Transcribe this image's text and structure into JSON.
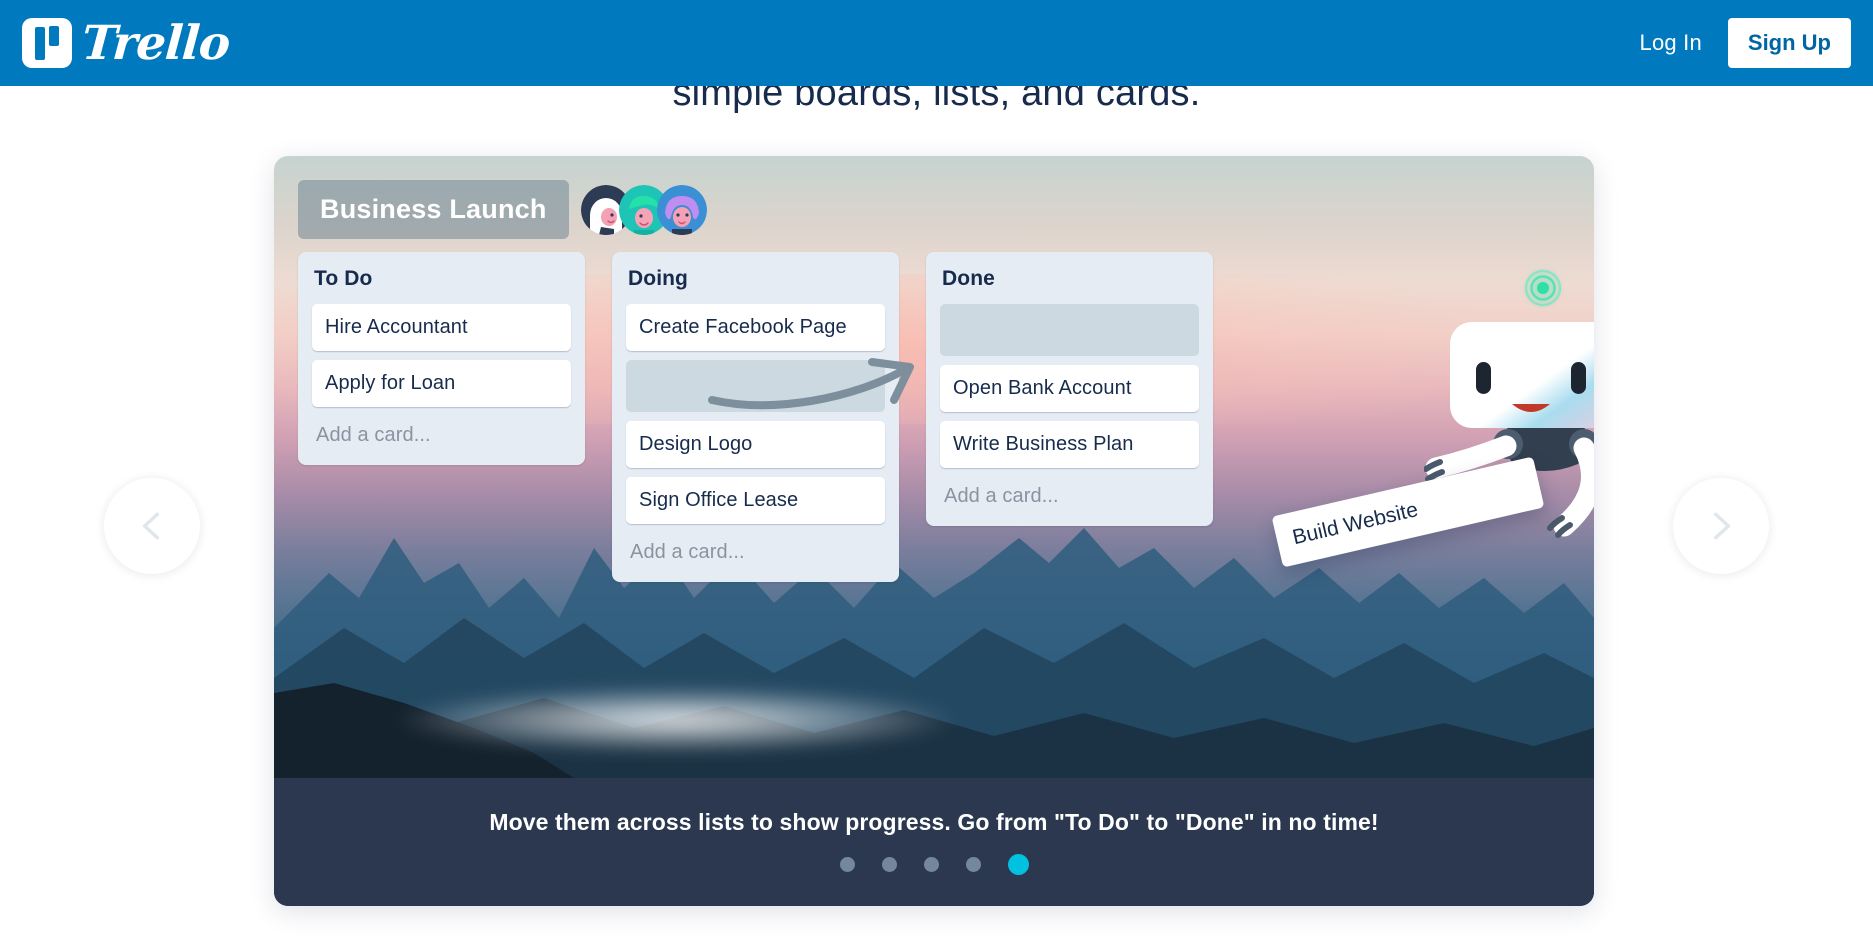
{
  "header": {
    "brand_name": "Trello",
    "login_label": "Log In",
    "signup_label": "Sign Up",
    "background_color": "#0079bf"
  },
  "hero": {
    "headline_fragment": "simple boards, lists, and cards."
  },
  "carousel": {
    "prev_label": "Previous slide",
    "next_label": "Next slide",
    "caption": "Move them across lists to show progress. Go from \"To Do\" to \"Done\" in no time!",
    "active_index": 4,
    "dot_count": 5,
    "active_dot_color": "#00c2e0",
    "inactive_dot_color": "#74879b",
    "caption_background": "#2b3850"
  },
  "board": {
    "title": "Business Launch",
    "members": [
      {
        "name": "member-avatar-1",
        "bg": "#2d3b55",
        "hair": "#ffffff",
        "skin": "#f4a0b5"
      },
      {
        "name": "member-avatar-2",
        "bg": "#1ec4b5",
        "hair": "#25e0a7",
        "skin": "#f6a3b8"
      },
      {
        "name": "member-avatar-3",
        "bg": "#3b8fd4",
        "hair": "#c08df0",
        "skin": "#f4a0b5"
      }
    ],
    "lists": [
      {
        "title": "To Do",
        "cards": [
          "Hire Accountant",
          "Apply for Loan"
        ],
        "slot_after": -1,
        "add_card_label": "Add a card..."
      },
      {
        "title": "Doing",
        "cards": [
          "Create Facebook Page",
          "Design Logo",
          "Sign Office Lease"
        ],
        "slot_after": 0,
        "add_card_label": "Add a card..."
      },
      {
        "title": "Done",
        "cards": [
          "Open Bank Account",
          "Write Business Plan"
        ],
        "slot_after": -2,
        "add_card_label": "Add a card..."
      }
    ],
    "dragged_card": "Build Website",
    "list_background": "#e6ecf4",
    "card_background": "#ffffff",
    "slot_background": "#ccd9e0",
    "text_color": "#172b4d"
  }
}
